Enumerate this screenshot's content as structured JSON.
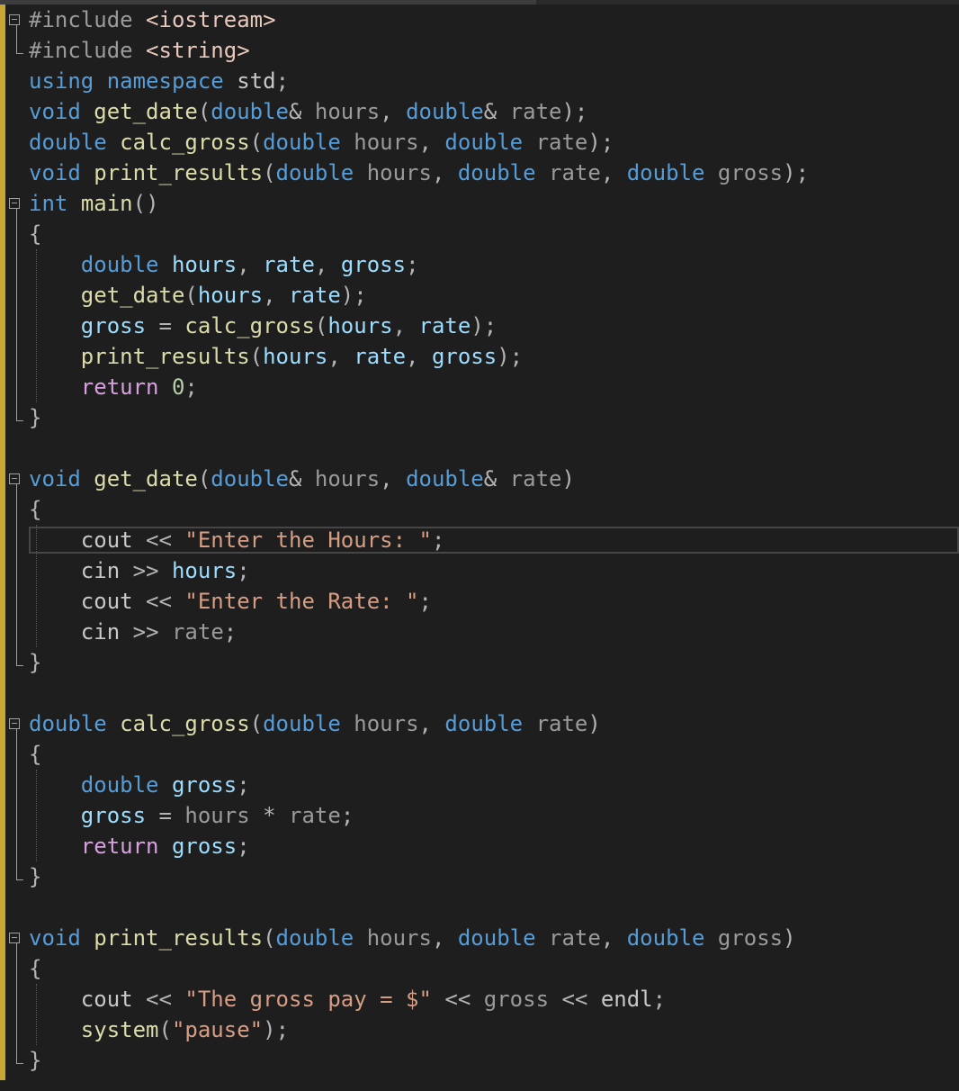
{
  "editor": {
    "lines": [
      "#include <iostream>",
      "#include <string>",
      "using namespace std;",
      "void get_date(double& hours, double& rate);",
      "double calc_gross(double hours, double rate);",
      "void print_results(double hours, double rate, double gross);",
      "int main()",
      "{",
      "    double hours, rate, gross;",
      "    get_date(hours, rate);",
      "    gross = calc_gross(hours, rate);",
      "    print_results(hours, rate, gross);",
      "    return 0;",
      "}",
      "",
      "void get_date(double& hours, double& rate)",
      "{",
      "    cout << \"Enter the Hours: \";",
      "    cin >> hours;",
      "    cout << \"Enter the Rate: \";",
      "    cin >> rate;",
      "}",
      "",
      "double calc_gross(double hours, double rate)",
      "{",
      "    double gross;",
      "    gross = hours * rate;",
      "    return gross;",
      "}",
      "",
      "void print_results(double hours, double rate, double gross)",
      "{",
      "    cout << \"The gross pay = $\" << gross << endl;",
      "    system(\"pause\");",
      "}"
    ],
    "colors": {
      "background": "#1e1e1e",
      "keyword": "#569cd6",
      "control_keyword": "#d8a0df",
      "function": "#dcdcaa",
      "string": "#d69d85",
      "parameter": "#9a9a9a",
      "local_variable": "#9cdcfe",
      "change_bar": "#c9a533"
    }
  }
}
